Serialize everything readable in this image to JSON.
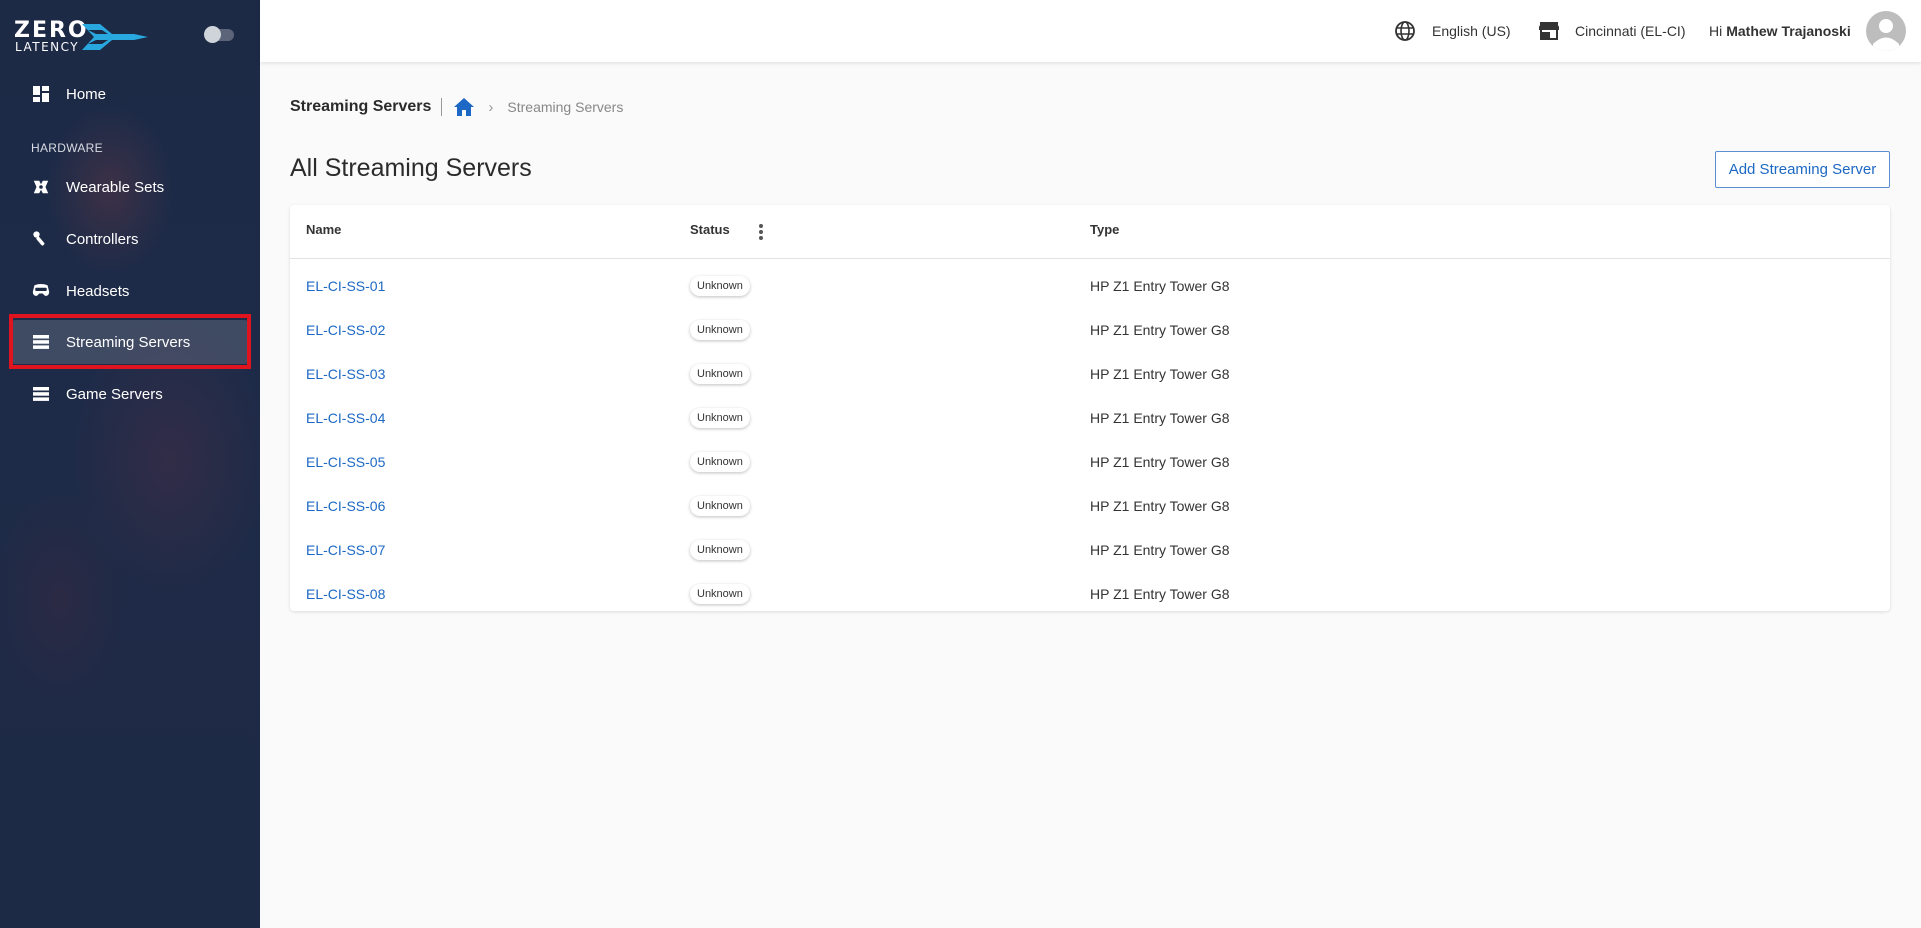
{
  "brand": {
    "line1": "ZERO",
    "line2": "LATENCY"
  },
  "sidebar": {
    "home": "Home",
    "section_label": "HARDWARE",
    "items": [
      {
        "label": "Wearable Sets",
        "icon": "wearable-icon"
      },
      {
        "label": "Controllers",
        "icon": "controller-icon"
      },
      {
        "label": "Headsets",
        "icon": "headset-icon"
      },
      {
        "label": "Streaming Servers",
        "icon": "server-icon",
        "active": true
      },
      {
        "label": "Game Servers",
        "icon": "server-icon"
      }
    ]
  },
  "topbar": {
    "language": "English (US)",
    "location": "Cincinnati (EL-CI)",
    "greeting": "Hi",
    "user_name": "Mathew Trajanoski"
  },
  "breadcrumb": {
    "title": "Streaming Servers",
    "current": "Streaming Servers"
  },
  "page": {
    "title": "All Streaming Servers",
    "add_button": "Add Streaming Server"
  },
  "table": {
    "columns": {
      "name": "Name",
      "status": "Status",
      "type": "Type"
    },
    "rows": [
      {
        "name": "EL-CI-SS-01",
        "status": "Unknown",
        "type": "HP Z1 Entry Tower G8"
      },
      {
        "name": "EL-CI-SS-02",
        "status": "Unknown",
        "type": "HP Z1 Entry Tower G8"
      },
      {
        "name": "EL-CI-SS-03",
        "status": "Unknown",
        "type": "HP Z1 Entry Tower G8"
      },
      {
        "name": "EL-CI-SS-04",
        "status": "Unknown",
        "type": "HP Z1 Entry Tower G8"
      },
      {
        "name": "EL-CI-SS-05",
        "status": "Unknown",
        "type": "HP Z1 Entry Tower G8"
      },
      {
        "name": "EL-CI-SS-06",
        "status": "Unknown",
        "type": "HP Z1 Entry Tower G8"
      },
      {
        "name": "EL-CI-SS-07",
        "status": "Unknown",
        "type": "HP Z1 Entry Tower G8"
      },
      {
        "name": "EL-CI-SS-08",
        "status": "Unknown",
        "type": "HP Z1 Entry Tower G8"
      }
    ]
  },
  "colors": {
    "sidebar_bg": "#1d2a45",
    "link": "#1d68c4",
    "active_outline": "#e0141e",
    "brand_accent": "#29a8e0"
  }
}
